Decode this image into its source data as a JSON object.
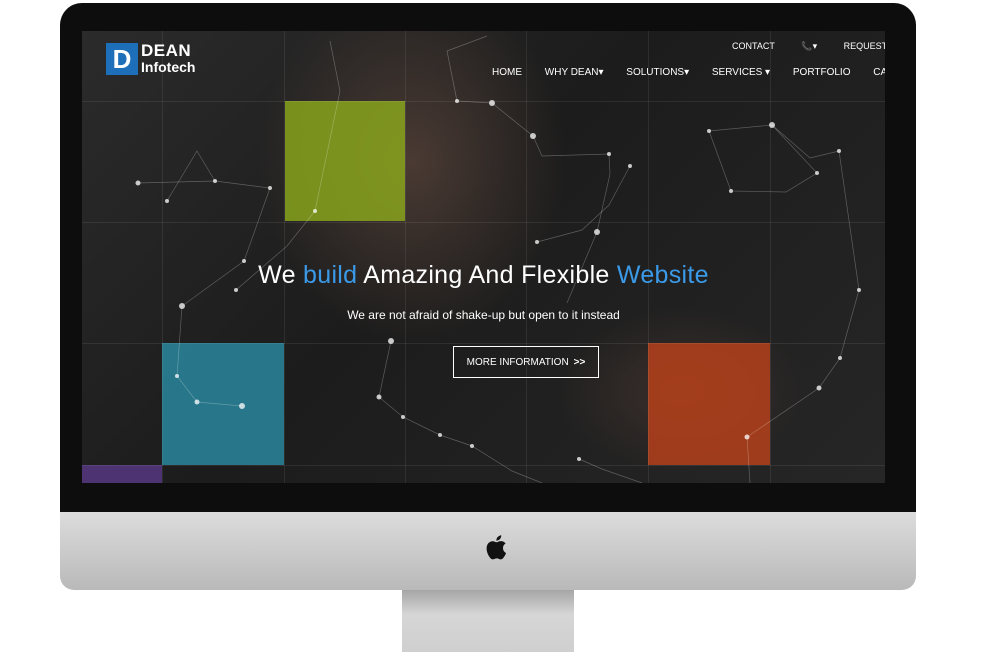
{
  "brand": {
    "mark": "D",
    "name_line1": "DEAN",
    "name_line2": "Infotech"
  },
  "topbar": {
    "contact": "CONTACT",
    "phone": "📞▾",
    "request": "REQUEST"
  },
  "nav": {
    "home": "HOME",
    "why": "WHY DEAN▾",
    "solutions": "SOLUTIONS▾",
    "services": "SERVICES ▾",
    "portfolio": "PORTFOLIO",
    "careers": "CAREE"
  },
  "hero": {
    "headline_part1": "We ",
    "headline_blue1": "build",
    "headline_part2": " Amazing And Flexible ",
    "headline_blue2": "Website",
    "subtitle": "We are not afraid of shake-up but open to it instead",
    "cta_label": "MORE INFORMATION",
    "cta_arrow": ">>"
  },
  "colors": {
    "accent_blue": "#3b9ae8",
    "tile_green": "#8fae1b",
    "tile_teal": "#2a8fa8",
    "tile_orange": "#c2421a",
    "tile_purple": "#5b3a8a"
  },
  "icons": {
    "apple": "apple-icon"
  }
}
